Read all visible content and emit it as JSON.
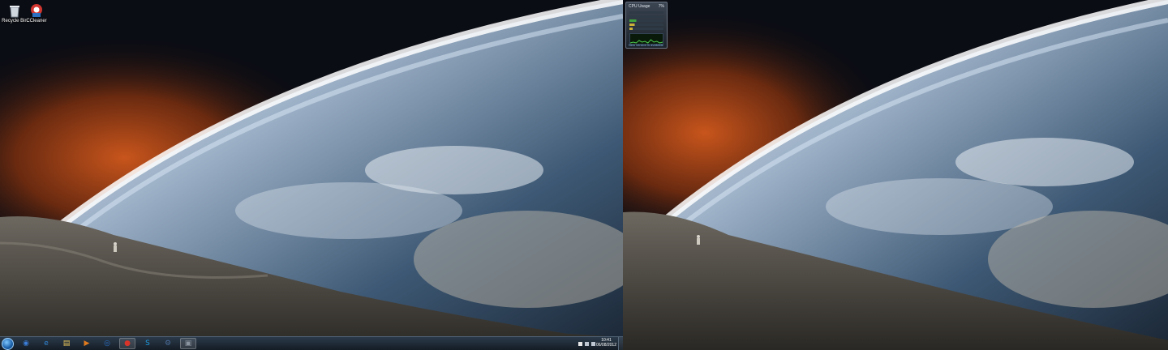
{
  "desktop": {
    "icons": [
      {
        "label": "Recycle Bin",
        "icon": "recycle-bin-icon"
      },
      {
        "label": "CCleaner",
        "icon": "ccleaner-icon"
      }
    ]
  },
  "gadget": {
    "title": "CPU Usage",
    "percent": "7%",
    "footer": "New version is available"
  },
  "taskbar": {
    "pinned": [
      {
        "name": "windows-explorer-ie-icon",
        "active": false
      },
      {
        "name": "internet-explorer-icon",
        "active": false
      },
      {
        "name": "folder-icon",
        "active": false
      },
      {
        "name": "media-player-icon",
        "active": false
      },
      {
        "name": "media-center-icon",
        "active": false
      },
      {
        "name": "chrome-icon",
        "active": true
      },
      {
        "name": "skype-icon",
        "active": false
      },
      {
        "name": "steam-icon",
        "active": false
      },
      {
        "name": "app-icon",
        "active": true
      }
    ],
    "clock": {
      "time": "10:41",
      "date": "06/08/2012"
    }
  },
  "colors": {
    "taskbar_top": "#2b3a4a",
    "taskbar_bottom": "#141c25",
    "accent": "#1a5fa8"
  }
}
